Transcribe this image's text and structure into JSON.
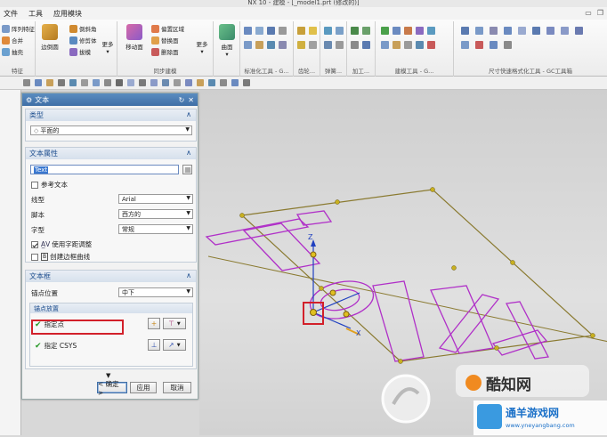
{
  "titlebar": {
    "text": "NX 10 - 建模 - [_model1.prt (修改的)]"
  },
  "menubar": {
    "items": [
      "文件",
      "工具",
      "应用模块"
    ]
  },
  "ribbon": {
    "groups": [
      {
        "label": "特征",
        "buttons": [
          "阵列特征",
          "合并",
          "抽壳"
        ]
      },
      {
        "label": "边倒圆",
        "buttons": [
          "边倒圆",
          "倒斜角",
          "修剪体",
          "拔模",
          "更多"
        ]
      },
      {
        "label": "同步建模",
        "buttons": [
          "移动面",
          "偏置区域",
          "替换面",
          "删除面",
          "更多"
        ]
      },
      {
        "label": "曲面",
        "buttons": [
          "曲面"
        ]
      },
      {
        "label": "标准化工具 - G...",
        "buttons": []
      },
      {
        "label": "齿轮...",
        "buttons": []
      },
      {
        "label": "弹簧...",
        "buttons": []
      },
      {
        "label": "加工...",
        "buttons": []
      },
      {
        "label": "建模工具 - G...",
        "buttons": []
      },
      {
        "label": "尺寸快速格式化工具 - GC工具箱",
        "buttons": []
      }
    ]
  },
  "dialog": {
    "title": "文本",
    "type_section": {
      "header": "类型",
      "value": "平面的"
    },
    "text_props": {
      "header": "文本属性",
      "text_value": "Text",
      "reference_text": "参考文本",
      "line_type_label": "线型",
      "line_type_value": "Arial",
      "script_label": "脚本",
      "script_value": "西方的",
      "style_label": "字型",
      "style_value": "常规",
      "kerning_label": "使用字距调整",
      "outline_label": "创建边框曲线"
    },
    "text_box": {
      "header": "文本框",
      "anchor_pos_label": "锚点位置",
      "anchor_pos_value": "中下",
      "anchor_place_header": "锚点放置",
      "specify_point": "指定点",
      "specify_csys": "指定 CSYS"
    },
    "buttons": {
      "ok": "< 确定 >",
      "apply": "应用",
      "cancel": "取消"
    }
  },
  "viewport": {
    "axis_z": "Z",
    "axis_x": "X"
  },
  "watermark": {
    "brand": "酷知网",
    "site_name": "通羊游戏网",
    "url": "www.yneyangbang.com"
  },
  "colors": {
    "title_blue": "#3f6fa6",
    "highlight_red": "#d2202a",
    "curve_magenta": "#b030c8",
    "frame_olive": "#8a7a30"
  }
}
